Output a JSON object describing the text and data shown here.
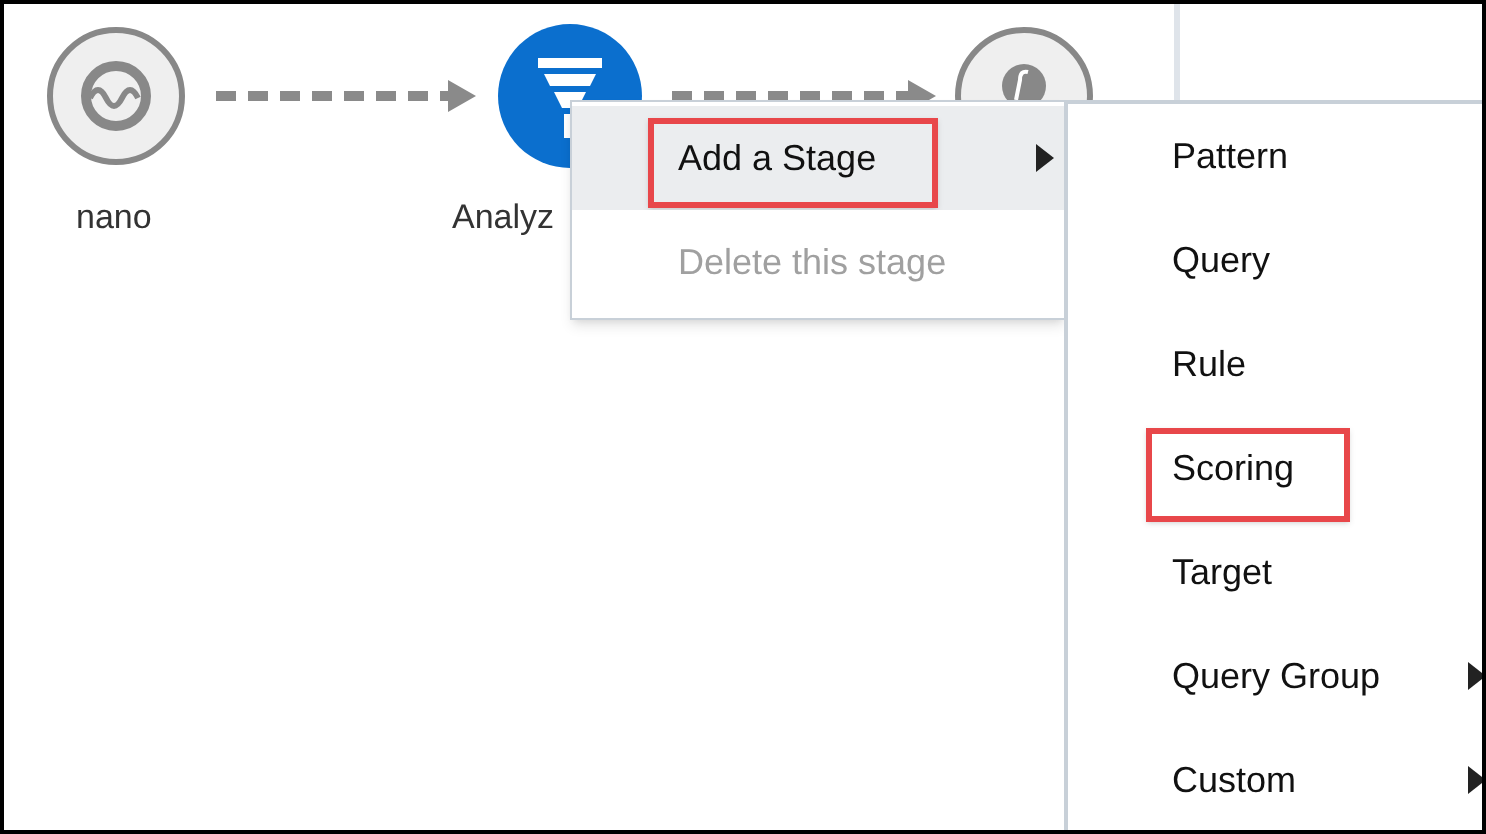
{
  "pipeline": {
    "nodes": [
      {
        "kind": "source",
        "label": "nano"
      },
      {
        "kind": "filter",
        "label": "Analyz"
      },
      {
        "kind": "function"
      }
    ]
  },
  "context_menu": {
    "items": [
      {
        "label": "Add a Stage",
        "selected": true,
        "disabled": false,
        "has_submenu": true,
        "annotated": true
      },
      {
        "label": "Delete this stage",
        "selected": false,
        "disabled": true,
        "has_submenu": false,
        "annotated": false
      }
    ]
  },
  "submenu": {
    "items": [
      {
        "label": "Pattern",
        "has_submenu": false,
        "annotated": false
      },
      {
        "label": "Query",
        "has_submenu": false,
        "annotated": false
      },
      {
        "label": "Rule",
        "has_submenu": false,
        "annotated": false
      },
      {
        "label": "Scoring",
        "has_submenu": false,
        "annotated": true
      },
      {
        "label": "Target",
        "has_submenu": false,
        "annotated": false
      },
      {
        "label": "Query Group",
        "has_submenu": true,
        "annotated": false
      },
      {
        "label": "Custom",
        "has_submenu": true,
        "annotated": false
      }
    ]
  }
}
